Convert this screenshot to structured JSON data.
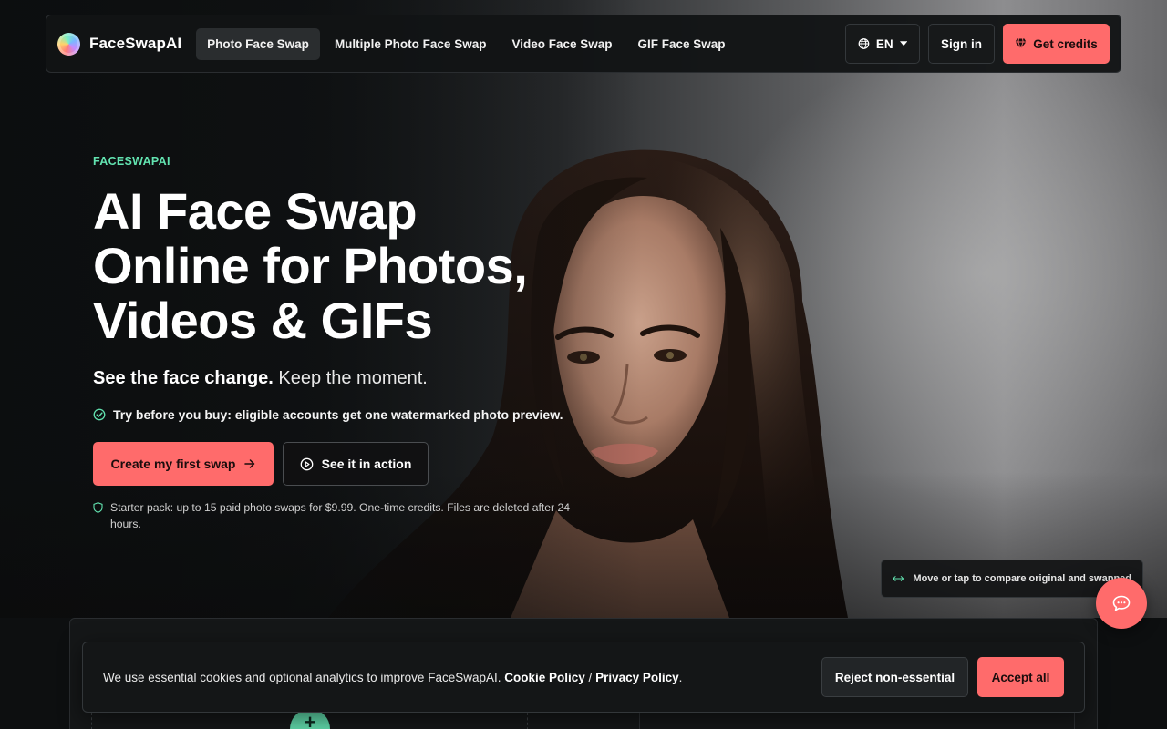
{
  "brand": {
    "name": "FaceSwapAI"
  },
  "nav": {
    "links": [
      {
        "label": "Photo Face Swap",
        "active": true
      },
      {
        "label": "Multiple Photo Face Swap",
        "active": false
      },
      {
        "label": "Video Face Swap",
        "active": false
      },
      {
        "label": "GIF Face Swap",
        "active": false
      }
    ],
    "language": "EN",
    "signin_label": "Sign in",
    "credits_label": "Get credits"
  },
  "hero": {
    "eyebrow": "FACESWAPAI",
    "headline_lines": [
      "AI Face Swap",
      "Online for Photos,",
      "Videos & GIFs"
    ],
    "subhead_bold": "See the face change.",
    "subhead_rest": " Keep the moment.",
    "trial_text": "Try before you buy: eligible accounts get one watermarked photo preview.",
    "cta_primary": "Create my first swap",
    "cta_secondary": "See it in action",
    "starter_text": "Starter pack: up to 15 paid photo swaps for $9.99. One-time credits. Files are deleted after 24 hours.",
    "compare_hint": "Move or tap to compare original and swapped"
  },
  "upload": {
    "plus_label": "+"
  },
  "cookie": {
    "text": "We use essential cookies and optional analytics to improve FaceSwapAI.",
    "cookie_policy": "Cookie Policy",
    "separator": "/",
    "privacy_policy": "Privacy Policy",
    "period": ".",
    "reject_label": "Reject non-essential",
    "accept_label": "Accept all"
  },
  "colors": {
    "accent": "#ff6b6b",
    "eyebrow": "#62e3b0",
    "background": "#0d0f10"
  },
  "icons": {
    "language": "globe-icon",
    "credits": "gem-icon",
    "cta_primary": "arrow-right-icon",
    "cta_secondary": "play-circle-icon",
    "trial": "check-circle-icon",
    "starter": "shield-icon",
    "compare": "arrows-horizontal-icon",
    "chat": "chat-bubble-icon"
  }
}
